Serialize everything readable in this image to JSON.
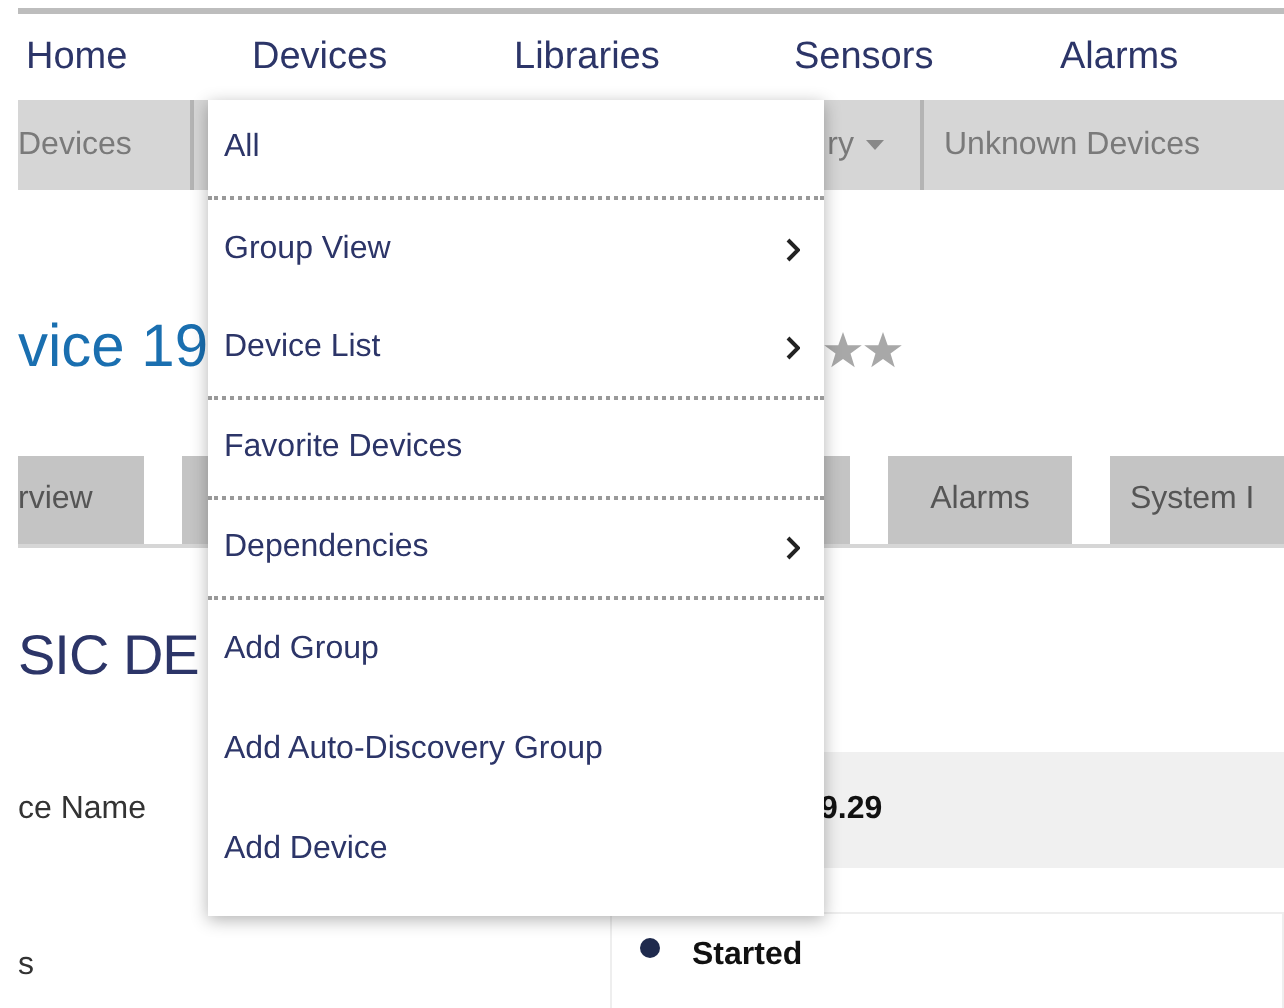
{
  "nav": [
    "Home",
    "Devices",
    "Libraries",
    "Sensors",
    "Alarms"
  ],
  "subnav": [
    {
      "label": "Devices",
      "dropdown": false
    },
    {
      "label": "ry",
      "dropdown": true
    },
    {
      "label": "Unknown Devices",
      "dropdown": false
    }
  ],
  "title": "vice 19",
  "tabs": [
    "rview",
    "Alarms",
    "System I"
  ],
  "section_title": "SIC DE",
  "fields": [
    {
      "label": "ce Name",
      "value": "9.29",
      "kind": "text"
    },
    {
      "label": "s",
      "value": "Started",
      "kind": "status"
    }
  ],
  "menu": [
    {
      "label": "All",
      "submenu": false,
      "separator_after": true
    },
    {
      "label": "Group View",
      "submenu": true,
      "separator_after": false
    },
    {
      "label": "Device List",
      "submenu": true,
      "separator_after": true
    },
    {
      "label": "Favorite Devices",
      "submenu": false,
      "separator_after": true
    },
    {
      "label": "Dependencies",
      "submenu": true,
      "separator_after": true
    },
    {
      "label": "Add Group",
      "submenu": false,
      "separator_after": false
    },
    {
      "label": "Add Auto-Discovery Group",
      "submenu": false,
      "separator_after": false
    },
    {
      "label": "Add Device",
      "submenu": false,
      "separator_after": false
    }
  ]
}
